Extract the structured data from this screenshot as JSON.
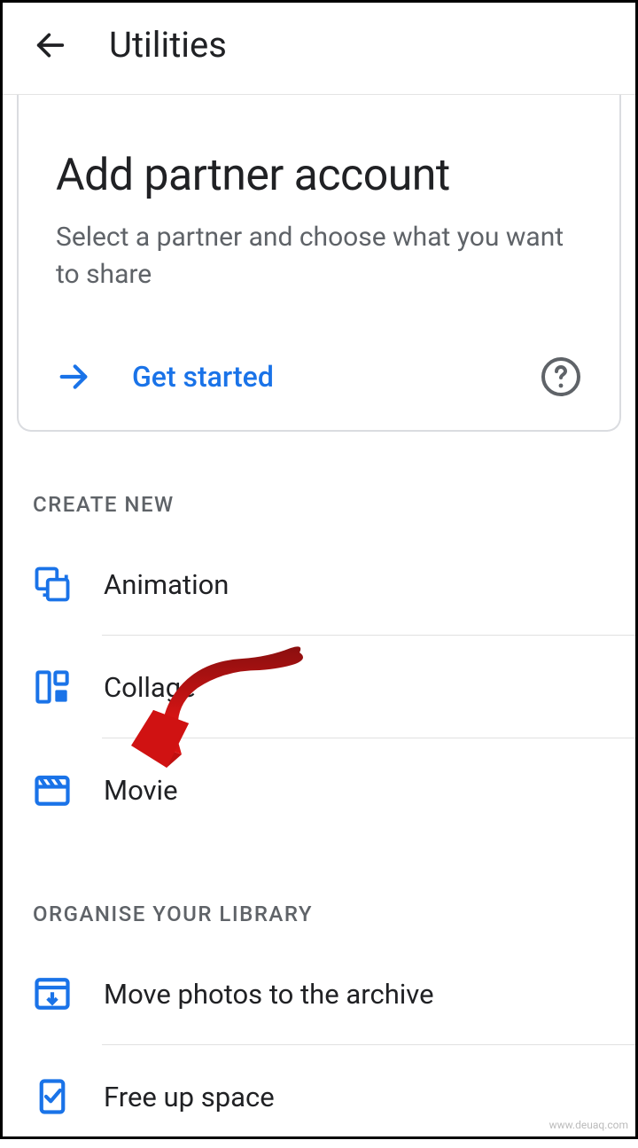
{
  "header": {
    "title": "Utilities"
  },
  "partner_card": {
    "title": "Add partner account",
    "subtitle": "Select a partner and choose what you want to share",
    "action_label": "Get started"
  },
  "sections": {
    "create_new": {
      "header": "CREATE NEW",
      "items": [
        {
          "label": "Animation"
        },
        {
          "label": "Collage"
        },
        {
          "label": "Movie"
        }
      ]
    },
    "organise": {
      "header": "ORGANISE YOUR LIBRARY",
      "items": [
        {
          "label": "Move photos to the archive"
        },
        {
          "label": "Free up space"
        }
      ]
    }
  },
  "watermark": "www.deuaq.com"
}
